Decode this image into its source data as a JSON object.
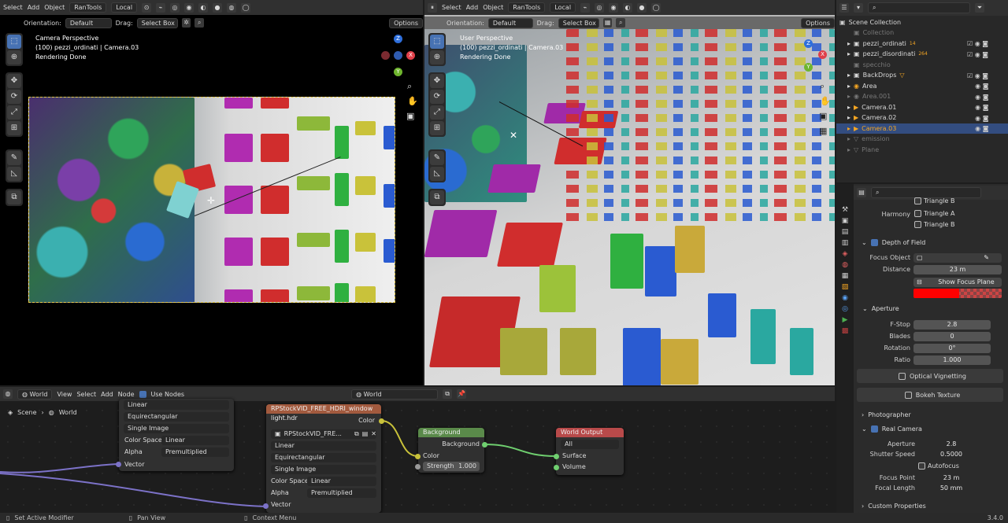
{
  "left_header": {
    "menus": [
      "Select",
      "Add",
      "Object"
    ],
    "ran_tools": "RanTools",
    "transform": "Local",
    "orientation_label": "Orientation:",
    "orientation_value": "Default",
    "drag_label": "Drag:",
    "drag_value": "Select Box",
    "options": "Options"
  },
  "right_header": {
    "menus": [
      "Select",
      "Add",
      "Object"
    ],
    "ran_tools": "RanTools",
    "transform": "Local",
    "orientation_label": "Orientation:",
    "orientation_value": "Default",
    "drag_label": "Drag:",
    "drag_value": "Select Box",
    "options": "Options"
  },
  "left_viewport": {
    "line1": "Camera Perspective",
    "line2": "(100) pezzi_ordinati | Camera.03",
    "line3": "Rendering Done"
  },
  "right_viewport": {
    "line1": "User Perspective",
    "line2": "(100) pezzi_ordinati | Camera.03",
    "line3": "Rendering Done"
  },
  "gizmo": {
    "x": "X",
    "y": "Y",
    "z": "Z"
  },
  "outliner": {
    "search_placeholder": "",
    "items": [
      {
        "name": "Scene Collection",
        "badge": ""
      },
      {
        "name": "Collection",
        "badge": ""
      },
      {
        "name": "pezzi_ordinati",
        "badge": "14"
      },
      {
        "name": "pezzi_disordinati",
        "badge": "264"
      },
      {
        "name": "specchio",
        "badge": ""
      },
      {
        "name": "BackDrops",
        "badge": ""
      },
      {
        "name": "Area",
        "badge": ""
      },
      {
        "name": "Area.001",
        "badge": ""
      },
      {
        "name": "Camera.01",
        "badge": ""
      },
      {
        "name": "Camera.02",
        "badge": ""
      },
      {
        "name": "Camera.03",
        "badge": ""
      },
      {
        "name": "emission",
        "badge": ""
      },
      {
        "name": "Plane",
        "badge": ""
      }
    ]
  },
  "properties": {
    "triangle_b_1": "Triangle B",
    "harmony": "Harmony",
    "triangle_a": "Triangle A",
    "triangle_b_2": "Triangle B",
    "dof_title": "Depth of Field",
    "focus_object_label": "Focus Object",
    "distance_label": "Distance",
    "distance_value": "23 m",
    "show_focus_plane": "Show Focus Plane",
    "aperture_title": "Aperture",
    "fstop_label": "F-Stop",
    "fstop_value": "2.8",
    "blades_label": "Blades",
    "blades_value": "0",
    "rotation_label": "Rotation",
    "rotation_value": "0°",
    "ratio_label": "Ratio",
    "ratio_value": "1.000",
    "optical_vignetting": "Optical Vignetting",
    "bokeh_texture": "Bokeh Texture",
    "photographer": "Photographer",
    "real_camera": "Real Camera",
    "rc_aperture_label": "Aperture",
    "rc_aperture_value": "2.8",
    "shutter_label": "Shutter Speed",
    "shutter_value": "0.5000",
    "autofocus": "Autofocus",
    "focus_point_label": "Focus Point",
    "focus_point_value": "23 m",
    "focal_length_label": "Focal Length",
    "focal_length_value": "50 mm",
    "custom_properties": "Custom Properties"
  },
  "node_header": {
    "world_type": "World",
    "menus": [
      "View",
      "Select",
      "Add",
      "Node"
    ],
    "use_nodes": "Use Nodes",
    "world_name": "World",
    "breadcrumb_scene": "Scene",
    "breadcrumb_world": "World"
  },
  "node_left": {
    "interp": "Linear",
    "proj": "Equirectangular",
    "source": "Single Image",
    "cs_label": "Color Space",
    "cs_value": "Linear",
    "alpha_label": "Alpha",
    "alpha_value": "Premultiplied",
    "vector": "Vector"
  },
  "node_env": {
    "title": "RPStockVID_FREE_HDRI_window light.hdr",
    "color_out": "Color",
    "image_name": "RPStockVID_FRE...",
    "interp": "Linear",
    "proj": "Equirectangular",
    "source": "Single Image",
    "cs_label": "Color Space",
    "cs_value": "Linear",
    "alpha_label": "Alpha",
    "alpha_value": "Premultiplied",
    "vector": "Vector"
  },
  "node_bg": {
    "title": "Background",
    "out": "Background",
    "color": "Color",
    "strength_label": "Strength",
    "strength_value": "1.000"
  },
  "node_wo": {
    "title": "World Output",
    "target": "All",
    "surface": "Surface",
    "volume": "Volume"
  },
  "status": {
    "left": "Set Active Modifier",
    "mid": "Pan View",
    "right": "Context Menu",
    "version": "3.4.0"
  },
  "colors": {
    "accent": "#4772b3",
    "selected_camera": "#f5a623",
    "focus_plane": "#ff0000",
    "env_header": "#a25a3e",
    "bg_header": "#5a8a4a",
    "wo_header": "#b84a4a"
  }
}
